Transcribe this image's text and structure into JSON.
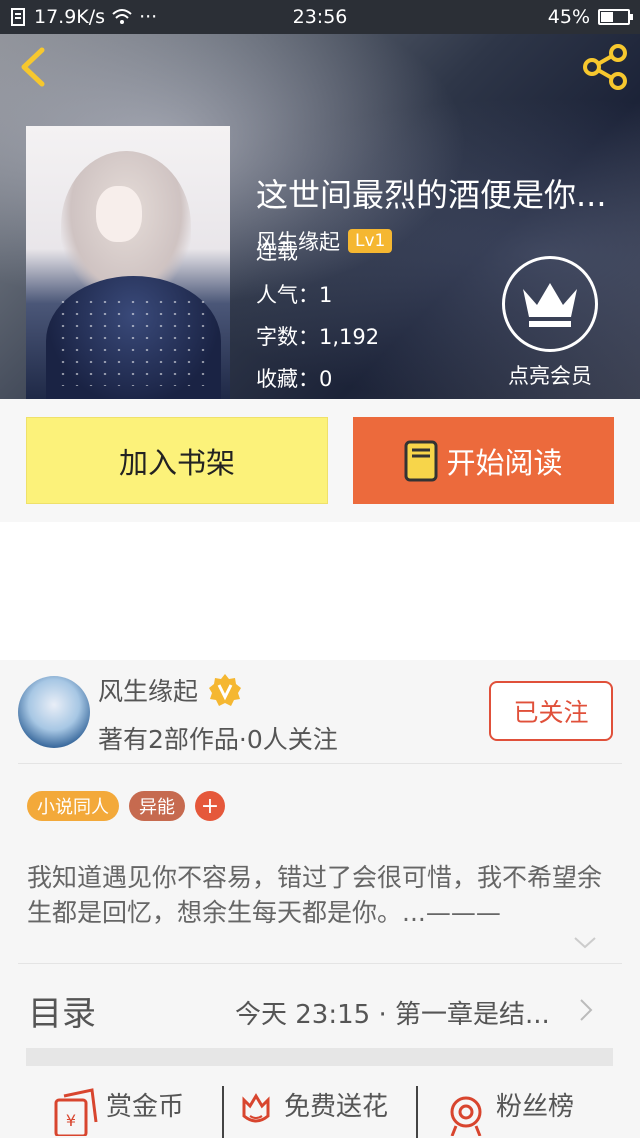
{
  "status_bar": {
    "net_speed": "17.9K/s",
    "dots": "···",
    "time": "23:56",
    "battery": "45%",
    "battery_level": 0.45
  },
  "book": {
    "title": "这世间最烈的酒便是你...",
    "author": "风生缘起",
    "level": "Lv1",
    "status": "连载",
    "popularity": "人气：1",
    "word_count": "字数：1,192",
    "favorites": "收藏：0"
  },
  "vip": {
    "label": "点亮会员"
  },
  "actions": {
    "add_to_shelf": "加入书架",
    "start_reading": "开始阅读"
  },
  "author_card": {
    "name": "风生缘起",
    "works_info": "著有2部作品·0人关注",
    "follow_label": "已关注"
  },
  "tags": [
    "小说同人",
    "异能"
  ],
  "tag_add": "+",
  "description": "我知道遇见你不容易，错过了会很可惜，我不希望余生都是回忆，想余生每天都是你。...———",
  "toc": {
    "label": "目录",
    "latest": "今天 23:15 · 第一章是结..."
  },
  "bottom": {
    "reward": "赏金币",
    "flower": "免费送花",
    "fans": "粉丝榜"
  },
  "colors": {
    "accent_orange": "#ec6a3c",
    "shelf_yellow": "#fcf27a",
    "follow_red": "#e0503a",
    "level_badge": "#f5b731"
  }
}
